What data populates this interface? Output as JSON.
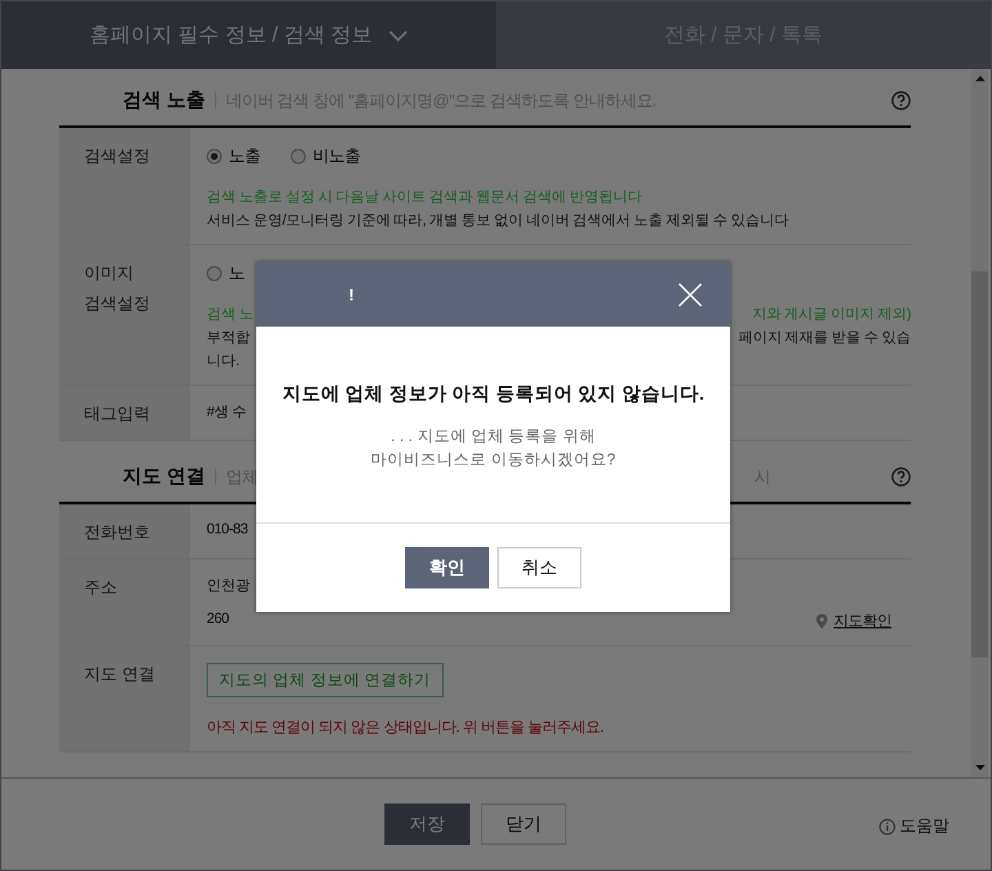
{
  "tabs": [
    {
      "label": "홈페이지 필수 정보 / 검색 정보",
      "selected": true,
      "dropdown": true
    },
    {
      "label": "전화 / 문자 / 톡톡",
      "selected": false,
      "dropdown": false
    }
  ],
  "sections": [
    {
      "title": "검색 노출",
      "description": "네이버 검색 창에 \"홈페이지명@\"으로 검색하도록 안내하세요.",
      "rows": [
        {
          "kind": "radio",
          "label_lines": [
            "검색설정"
          ],
          "options": [
            {
              "label": "노출",
              "selected": true
            },
            {
              "label": "비노출",
              "selected": false
            }
          ],
          "notes": [
            {
              "left": "검색 노출로 설정 시 다음날 사이트 검색과 웹문서 검색에 반영됩니다",
              "kind": "notice"
            },
            {
              "left": "서비스 운영/모니터링 기준에 따라, 개별 통보 없이 네이버 검색에서 노출 제외될 수 있습니다",
              "kind": "plain"
            }
          ]
        },
        {
          "kind": "radio",
          "label_lines": [
            "이미지",
            "검색설정"
          ],
          "options": [
            {
              "label": "노",
              "selected": false
            }
          ],
          "notes": [
            {
              "left": "검색 노",
              "right": "지와 게시글 이미지 제외)",
              "kind": "notice"
            },
            {
              "left": "부적합",
              "right": "페이지 제재를 받을 수 있습",
              "kind": "plain"
            },
            {
              "left": "니다.",
              "kind": "plain"
            }
          ]
        },
        {
          "kind": "text",
          "label_lines": [
            "태그입력"
          ],
          "value": "#생 수"
        }
      ]
    },
    {
      "title": "지도 연결",
      "description": "업체",
      "description_right": "시",
      "rows": [
        {
          "kind": "text",
          "label_lines": [
            "전화번호"
          ],
          "value": "010-83"
        },
        {
          "kind": "address",
          "label_lines": [
            "주소"
          ],
          "lines": [
            "인천광",
            "260"
          ],
          "link": "지도확인"
        },
        {
          "kind": "connect",
          "label_lines": [
            "지도 연결"
          ],
          "button": "지도의 업체 정보에 연결하기",
          "warning": "아직 지도 연결이 되지 않은 상태입니다. 위 버튼을 눌러주세요."
        }
      ]
    }
  ],
  "footer": {
    "buttons": [
      {
        "label": "저장",
        "primary": true
      },
      {
        "label": "닫기",
        "primary": false
      }
    ],
    "help": "도움말"
  },
  "modal": {
    "icon": "!",
    "title": "지도에 업체 정보가 아직 등록되어 있지 않습니다.",
    "message_lines": [
      ". . . 지도에 업체 등록을 위해",
      "마이비즈니스로 이동하시겠어요?"
    ],
    "buttons": [
      {
        "label": "확인",
        "primary": true
      },
      {
        "label": "취소",
        "primary": false
      }
    ]
  }
}
